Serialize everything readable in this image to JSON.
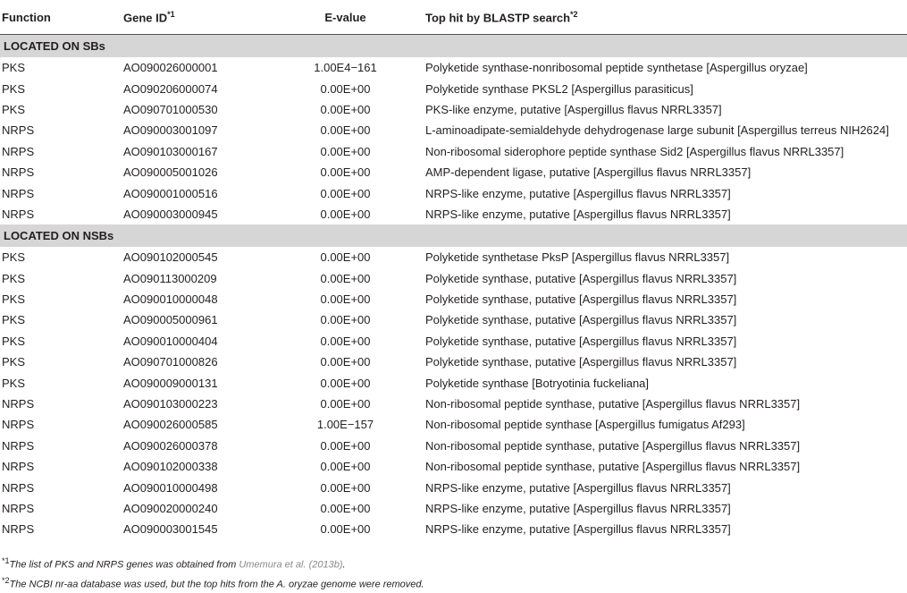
{
  "headers": {
    "function": "Function",
    "gene_id": "Gene ID",
    "gene_id_sup": "*1",
    "evalue": "E-value",
    "top_hit": "Top hit by BLASTP search",
    "top_hit_sup": "*2"
  },
  "sections": [
    {
      "title": "LOCATED ON SBs",
      "rows": [
        {
          "function": "PKS",
          "gene_id": "AO090026000001",
          "evalue": "1.00E4−161",
          "hit": "Polyketide synthase-nonribosomal peptide synthetase [Aspergillus oryzae]"
        },
        {
          "function": "PKS",
          "gene_id": "AO090206000074",
          "evalue": "0.00E+00",
          "hit": "Polyketide synthase PKSL2 [Aspergillus parasiticus]"
        },
        {
          "function": "PKS",
          "gene_id": "AO090701000530",
          "evalue": "0.00E+00",
          "hit": "PKS-like enzyme, putative [Aspergillus flavus NRRL3357]"
        },
        {
          "function": "NRPS",
          "gene_id": "AO090003001097",
          "evalue": "0.00E+00",
          "hit": "L-aminoadipate-semialdehyde dehydrogenase large subunit [Aspergillus terreus NIH2624]"
        },
        {
          "function": "NRPS",
          "gene_id": "AO090103000167",
          "evalue": "0.00E+00",
          "hit": "Non-ribosomal siderophore peptide synthase Sid2 [Aspergillus flavus NRRL3357]"
        },
        {
          "function": "NRPS",
          "gene_id": "AO090005001026",
          "evalue": "0.00E+00",
          "hit": "AMP-dependent ligase, putative [Aspergillus flavus NRRL3357]"
        },
        {
          "function": "NRPS",
          "gene_id": "AO090001000516",
          "evalue": "0.00E+00",
          "hit": "NRPS-like enzyme, putative [Aspergillus flavus NRRL3357]"
        },
        {
          "function": "NRPS",
          "gene_id": "AO090003000945",
          "evalue": "0.00E+00",
          "hit": "NRPS-like enzyme, putative [Aspergillus flavus NRRL3357]"
        }
      ]
    },
    {
      "title": "LOCATED ON NSBs",
      "rows": [
        {
          "function": "PKS",
          "gene_id": "AO090102000545",
          "evalue": "0.00E+00",
          "hit": "Polyketide synthetase PksP [Aspergillus flavus NRRL3357]"
        },
        {
          "function": "PKS",
          "gene_id": "AO090113000209",
          "evalue": "0.00E+00",
          "hit": "Polyketide synthase, putative [Aspergillus flavus NRRL3357]"
        },
        {
          "function": "PKS",
          "gene_id": "AO090010000048",
          "evalue": "0.00E+00",
          "hit": "Polyketide synthase, putative [Aspergillus flavus NRRL3357]"
        },
        {
          "function": "PKS",
          "gene_id": "AO090005000961",
          "evalue": "0.00E+00",
          "hit": "Polyketide synthase, putative [Aspergillus flavus NRRL3357]"
        },
        {
          "function": "PKS",
          "gene_id": "AO090010000404",
          "evalue": "0.00E+00",
          "hit": "Polyketide synthase, putative [Aspergillus flavus NRRL3357]"
        },
        {
          "function": "PKS",
          "gene_id": "AO090701000826",
          "evalue": "0.00E+00",
          "hit": "Polyketide synthase, putative [Aspergillus flavus NRRL3357]"
        },
        {
          "function": "PKS",
          "gene_id": "AO090009000131",
          "evalue": "0.00E+00",
          "hit": "Polyketide synthase [Botryotinia fuckeliana]"
        },
        {
          "function": "NRPS",
          "gene_id": "AO090103000223",
          "evalue": "0.00E+00",
          "hit": "Non-ribosomal peptide synthase, putative [Aspergillus flavus NRRL3357]"
        },
        {
          "function": "NRPS",
          "gene_id": "AO090026000585",
          "evalue": "1.00E−157",
          "hit": "Non-ribosomal peptide synthase [Aspergillus fumigatus Af293]"
        },
        {
          "function": "NRPS",
          "gene_id": "AO090026000378",
          "evalue": "0.00E+00",
          "hit": "Non-ribosomal peptide synthase, putative [Aspergillus flavus NRRL3357]"
        },
        {
          "function": "NRPS",
          "gene_id": "AO090102000338",
          "evalue": "0.00E+00",
          "hit": "Non-ribosomal peptide synthase, putative [Aspergillus flavus NRRL3357]"
        },
        {
          "function": "NRPS",
          "gene_id": "AO090010000498",
          "evalue": "0.00E+00",
          "hit": "NRPS-like enzyme, putative [Aspergillus flavus NRRL3357]"
        },
        {
          "function": "NRPS",
          "gene_id": "AO090020000240",
          "evalue": "0.00E+00",
          "hit": "NRPS-like enzyme, putative [Aspergillus flavus NRRL3357]"
        },
        {
          "function": "NRPS",
          "gene_id": "AO090003001545",
          "evalue": "0.00E+00",
          "hit": "NRPS-like enzyme, putative [Aspergillus flavus NRRL3357]"
        }
      ]
    }
  ],
  "footnotes": {
    "note1_mark": "*1",
    "note1_text": "The list of PKS and NRPS genes was obtained from ",
    "note1_link": "Umemura et al. (2013b)",
    "note1_end": ".",
    "note2_mark": "*2",
    "note2_text": "The NCBI nr-aa database was used, but the top hits from the A. oryzae genome were removed."
  }
}
